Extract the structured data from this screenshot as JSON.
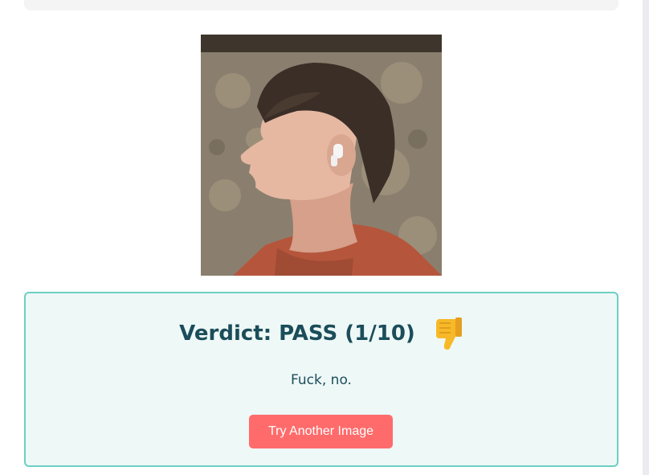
{
  "verdict": {
    "title": "Verdict: PASS (1/10)",
    "emoji_icon": "thumbs-down-icon",
    "message": "Fuck, no.",
    "try_again_label": "Try Another Image"
  },
  "colors": {
    "accent": "#ff6b6b",
    "card_border": "#6ccfc4",
    "card_bg": "#eef8f7",
    "text": "#1b4d5a"
  },
  "photo": {
    "subject": "profile-portrait-with-earbud"
  }
}
